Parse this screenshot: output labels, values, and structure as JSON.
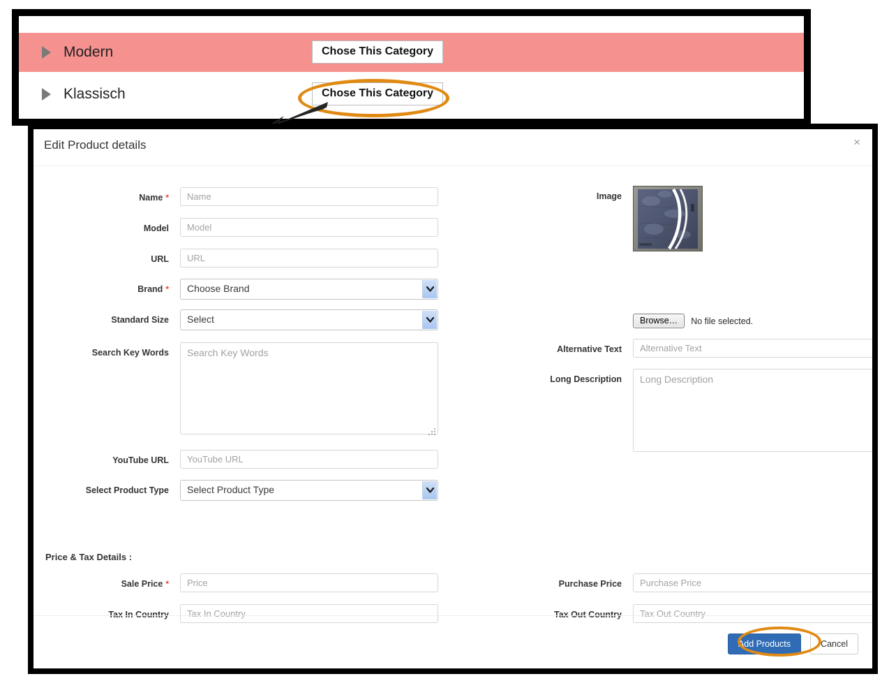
{
  "category_panel": {
    "rows": [
      {
        "label": "Modern",
        "button_label": "Chose This Category",
        "highlighted": true
      },
      {
        "label": "Klassisch",
        "button_label": "Chose This Category",
        "highlighted": false
      }
    ],
    "highlight_color": "#f5918f"
  },
  "annotations": {
    "ellipse_color": "#e08a14",
    "arrow_color": "#1f1f1f"
  },
  "modal": {
    "title": "Edit Product details",
    "close_label": "×",
    "left_fields": {
      "name": {
        "label": "Name",
        "required": "*",
        "placeholder": "Name",
        "value": ""
      },
      "model": {
        "label": "Model",
        "required": "",
        "placeholder": "Model",
        "value": ""
      },
      "url": {
        "label": "URL",
        "required": "",
        "placeholder": "URL",
        "value": ""
      },
      "brand": {
        "label": "Brand",
        "required": "*",
        "selected": "Choose Brand"
      },
      "standard_size": {
        "label": "Standard Size",
        "required": "",
        "selected": "Select"
      },
      "search_key_words": {
        "label": "Search Key Words",
        "required": "",
        "placeholder": "Search Key Words",
        "value": ""
      },
      "youtube_url": {
        "label": "YouTube URL",
        "required": "",
        "placeholder": "YouTube URL",
        "value": ""
      },
      "product_type": {
        "label": "Select Product Type",
        "required": "",
        "selected": "Select Product Type"
      }
    },
    "right_fields": {
      "image": {
        "label": "Image",
        "alt_text": "door-thumbnail"
      },
      "file_upload": {
        "browse_label": "Browse…",
        "status": "No file selected."
      },
      "alternative_text": {
        "label": "Alternative Text",
        "placeholder": "Alternative Text",
        "value": ""
      },
      "long_description": {
        "label": "Long Description",
        "placeholder": "Long Description",
        "value": ""
      }
    },
    "price_tax": {
      "heading": "Price & Tax Details :",
      "sale_price": {
        "label": "Sale Price",
        "required": "*",
        "placeholder": "Price",
        "value": ""
      },
      "tax_in_country": {
        "label": "Tax In Country",
        "required": "",
        "placeholder": "Tax In Country",
        "value": ""
      },
      "purchase_price": {
        "label": "Purchase Price",
        "required": "",
        "placeholder": "Purchase Price",
        "value": ""
      },
      "tax_out_country": {
        "label": "Tax Out Country",
        "required": "",
        "placeholder": "Tax Out Country",
        "value": ""
      }
    },
    "footer": {
      "submit_label": "Add Products",
      "cancel_label": "Cancel",
      "submit_color": "#2f6cb5"
    }
  }
}
